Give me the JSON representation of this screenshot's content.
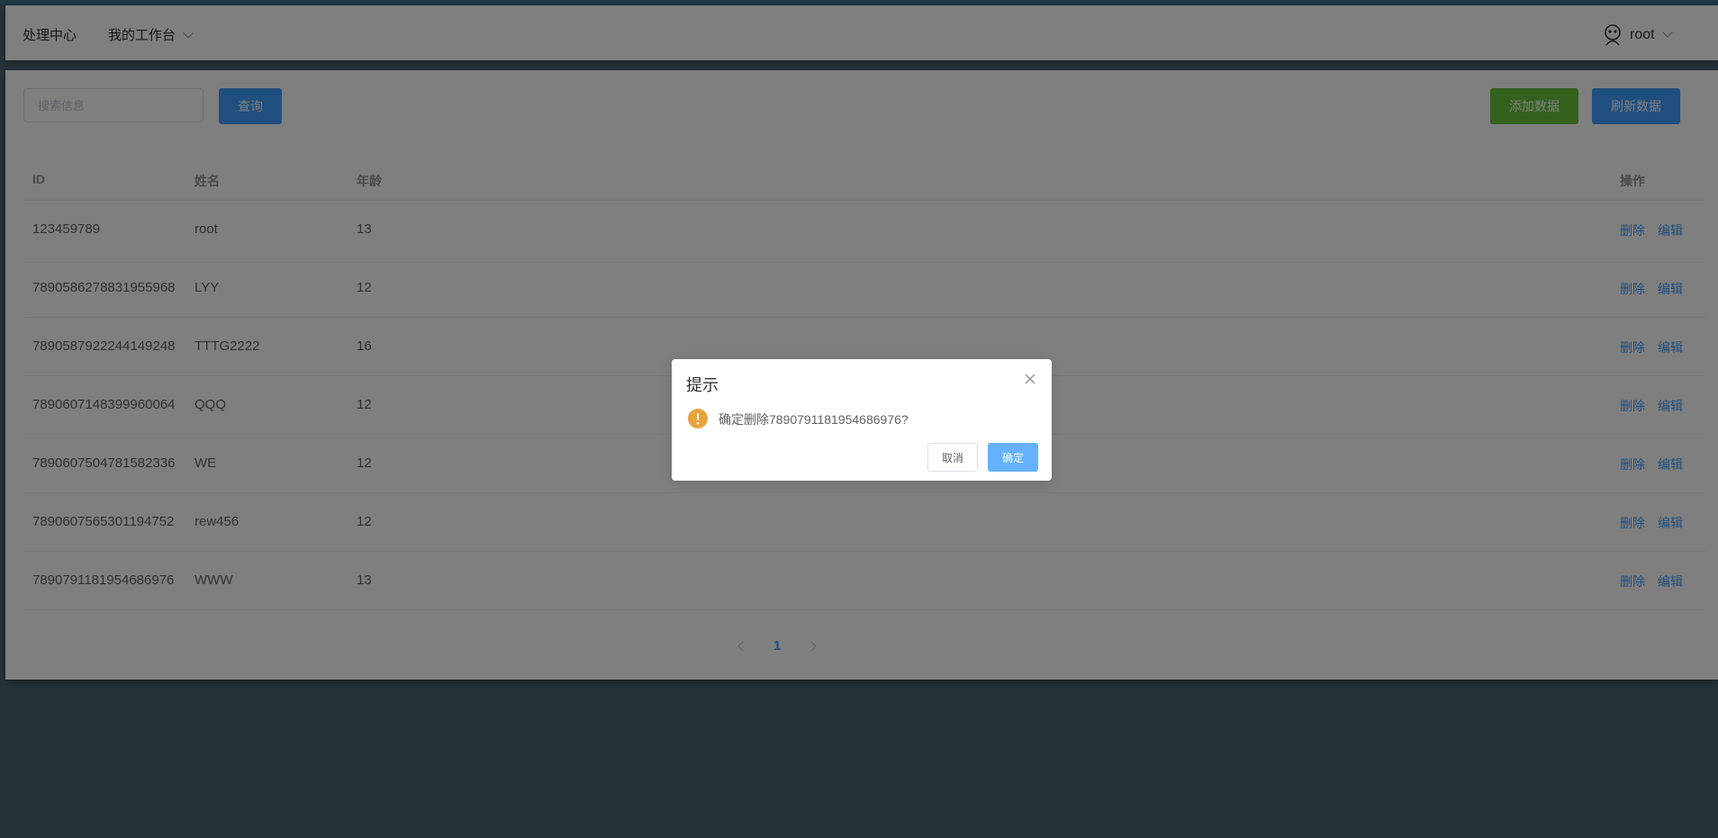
{
  "nav": {
    "home": "处理中心",
    "workspace": "我的工作台",
    "user": "root"
  },
  "toolbar": {
    "search_placeholder": "搜索信息",
    "query_label": "查询",
    "add_label": "添加数据",
    "refresh_label": "刷新数据"
  },
  "table": {
    "headers": {
      "id": "ID",
      "name": "姓名",
      "age": "年龄",
      "op": "操作"
    },
    "rows": [
      {
        "id": "123459789",
        "name": "root",
        "age": "13"
      },
      {
        "id": "7890586278831955968",
        "name": "LYY",
        "age": "12"
      },
      {
        "id": "7890587922244149248",
        "name": "TTTG2222",
        "age": "16"
      },
      {
        "id": "7890607148399960064",
        "name": "QQQ",
        "age": "12"
      },
      {
        "id": "7890607504781582336",
        "name": "WE",
        "age": "12"
      },
      {
        "id": "7890607565301194752",
        "name": "rew456",
        "age": "12"
      },
      {
        "id": "7890791181954686976",
        "name": "WWW",
        "age": "13"
      }
    ],
    "delete_label": "删除",
    "edit_label": "编辑"
  },
  "pagination": {
    "current": "1"
  },
  "dialog": {
    "title": "提示",
    "message": "确定删除7890791181954686976?",
    "cancel_label": "取消",
    "confirm_label": "确定"
  },
  "colors": {
    "primary": "#409eff",
    "success": "#67c23a",
    "warning": "#e6a23c"
  },
  "icons": {
    "user_avatar": "avatar-icon",
    "dialog_status": "warning-icon",
    "dialog_close": "close-icon"
  }
}
